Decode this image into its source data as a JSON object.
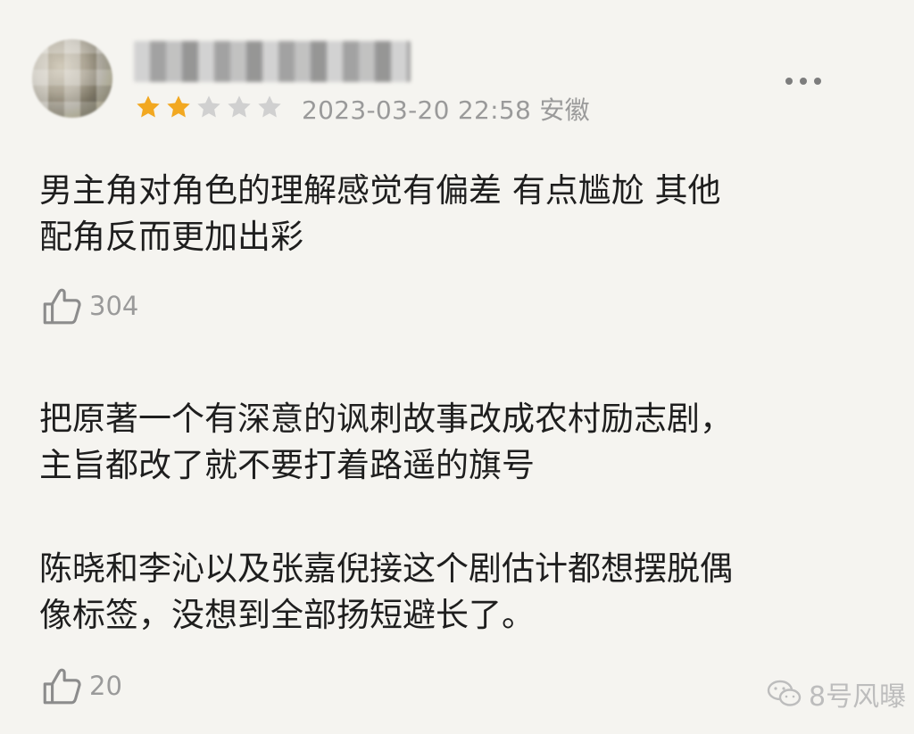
{
  "review": {
    "rating": 2,
    "rating_max": 5,
    "meta": "2023-03-20 22:58 安徽",
    "text": "男主角对角色的理解感觉有偏差 有点尴尬 其他\n配角反而更加出彩",
    "likes": "304"
  },
  "second": {
    "paragraph1": "把原著一个有深意的讽刺故事改成农村励志剧，\n主旨都改了就不要打着路遥的旗号",
    "paragraph2": "陈晓和李沁以及张嘉倪接这个剧估计都想摆脱偶\n像标签，没想到全部扬短避长了。",
    "likes": "20"
  },
  "watermark": {
    "text": "8号风曝"
  },
  "colors": {
    "star_on": "#f2a821",
    "star_off": "#d0d0d0",
    "muted": "#9a9a9a",
    "bg": "#f5f4f0"
  },
  "icons": {
    "like": "thumbs-up-icon",
    "more": "more-dots-icon",
    "watermark": "wechat-icon"
  }
}
